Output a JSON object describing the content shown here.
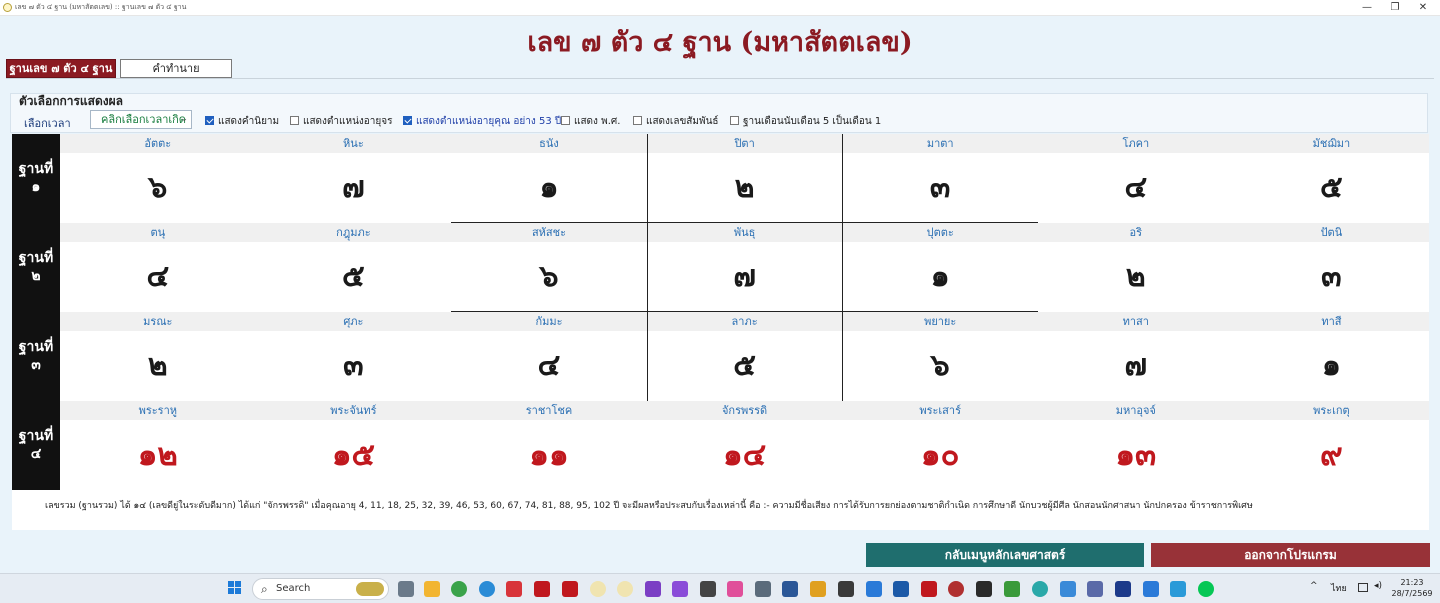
{
  "window": {
    "title": "เลข ๗ ตัว ๔ ฐาน (มหาสัตตเลข) :: ฐานเลข ๗ ตัว ๔ ฐาน",
    "minimize": "—",
    "maximize": "❐",
    "close": "✕"
  },
  "header": {
    "title": "เลข ๗ ตัว ๔ ฐาน (มหาสัตตเลข)"
  },
  "tabs": [
    {
      "label": "ฐานเลข ๗ ตัว ๔ ฐาน"
    },
    {
      "label": "คำทำนาย"
    }
  ],
  "options": {
    "title": "ตัวเลือกการแสดงผล",
    "time_label": "เลือกเวลา",
    "time_select": "คลิกเลือกเวลาเกิด",
    "checkboxes": [
      {
        "label": "แสดงคำนิยาม",
        "checked": true
      },
      {
        "label": "แสดงตำแหน่งอายุจร",
        "checked": false
      },
      {
        "label": "แสดงตำแหน่งอายุคุณ อย่าง 53 ปี",
        "checked": true
      },
      {
        "label": "แสดง พ.ศ.",
        "checked": false
      },
      {
        "label": "แสดงเลขสัมพันธ์",
        "checked": false
      },
      {
        "label": "ฐานเดือนนับเดือน 5 เป็นเดือน 1",
        "checked": false
      }
    ]
  },
  "rows": [
    {
      "label_top": "ฐานที่",
      "label_bottom": "๑",
      "names": [
        "อัตตะ",
        "หินะ",
        "ธนัง",
        "ปิตา",
        "มาตา",
        "โภคา",
        "มัชฌิมา"
      ],
      "numbers": [
        "๖",
        "๗",
        "๑",
        "๒",
        "๓",
        "๔",
        "๕"
      ]
    },
    {
      "label_top": "ฐานที่",
      "label_bottom": "๒",
      "names": [
        "ตนุ",
        "กฎุมภะ",
        "สหัสชะ",
        "พันธุ",
        "ปุตตะ",
        "อริ",
        "ปัตนิ"
      ],
      "numbers": [
        "๔",
        "๕",
        "๖",
        "๗",
        "๑",
        "๒",
        "๓"
      ]
    },
    {
      "label_top": "ฐานที่",
      "label_bottom": "๓",
      "names": [
        "มรณะ",
        "ศุภะ",
        "กัมมะ",
        "ลาภะ",
        "พยายะ",
        "ทาสา",
        "ทาสี"
      ],
      "numbers": [
        "๒",
        "๓",
        "๔",
        "๕",
        "๖",
        "๗",
        "๑"
      ]
    },
    {
      "label_top": "ฐานที่",
      "label_bottom": "๔",
      "names": [
        "พระราหู",
        "พระจันทร์",
        "ราชาโชค",
        "จักรพรรดิ",
        "พระเสาร์",
        "มหาอุจจ์",
        "พระเกตุ"
      ],
      "numbers": [
        "๑๒",
        "๑๕",
        "๑๑",
        "๑๔",
        "๑๐",
        "๑๓",
        "๙"
      ]
    }
  ],
  "summary": "เลขรวม (ฐานรวม) ได้ ๑๔  (เลขดียู่ในระดับดีมาก) ได้แก่ \"จักรพรรดิ\"  เมื่อคุณอายุ 4, 11, 18, 25, 32, 39, 46, 53, 60, 67, 74, 81, 88, 95, 102  ปี จะมีผลหรือประสบกับเรื่องเหล่านี้ คือ :-  ความมีชื่อเสียง  การได้รับการยกย่องตามชาติกำเนิด  การศึกษาดี  นักบวชผู้มีศีล  นักสอนนักศาสนา  นักปกครอง  ข้าราชการพิเศษ",
  "buttons": {
    "menu": "กลับเมนูหลักเลขศาสตร์",
    "exit": "ออกจากโปรแกรม"
  },
  "taskbar": {
    "search_placeholder": "Search",
    "lang": "ไทย",
    "time": "21:23",
    "date": "28/7/2569"
  },
  "colors": {
    "title": "#8b1a22",
    "tab_active": "#8b1a22",
    "row_label_bg": "#111111",
    "name_text": "#2a6fb3",
    "red_number": "#c0181e",
    "btn_menu": "#1f6e6e",
    "btn_exit": "#983238"
  }
}
